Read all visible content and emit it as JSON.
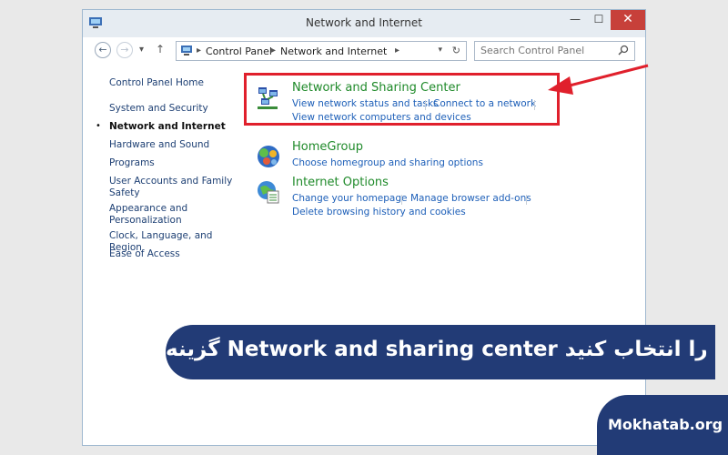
{
  "window": {
    "title": "Network and Internet",
    "min_glyph": "—",
    "max_glyph": "☐",
    "close_glyph": "✕"
  },
  "address": {
    "back_glyph": "←",
    "forward_glyph": "→",
    "recent_glyph": "▾",
    "up_glyph": "↑",
    "crumbs": [
      "Control Panel",
      "Network and Internet"
    ],
    "sep_glyph": "▸",
    "dropdown_glyph": "▾",
    "refresh_glyph": "↻",
    "search_placeholder": "Search Control Panel"
  },
  "sidebar": {
    "items": [
      {
        "label": "Control Panel Home"
      },
      {
        "label": "System and Security"
      },
      {
        "label": "Network and Internet",
        "active": true
      },
      {
        "label": "Hardware and Sound"
      },
      {
        "label": "Programs"
      },
      {
        "label": "User Accounts and Family Safety"
      },
      {
        "label": "Appearance and Personalization"
      },
      {
        "label": "Clock, Language, and Region"
      },
      {
        "label": "Ease of Access"
      }
    ],
    "bullet": "•"
  },
  "categories": [
    {
      "title": "Network and Sharing Center",
      "icon": "network-sharing-icon",
      "links": [
        "View network status and tasks",
        "Connect to a network",
        "View network computers and devices"
      ]
    },
    {
      "title": "HomeGroup",
      "icon": "homegroup-icon",
      "links": [
        "Choose homegroup and sharing options"
      ]
    },
    {
      "title": "Internet Options",
      "icon": "internet-options-icon",
      "links": [
        "Change your homepage",
        "Manage browser add-ons",
        "Delete browsing history and cookies"
      ]
    }
  ],
  "overlay": {
    "banner_text": "گزینه Network and sharing center را انتخاب کنید",
    "brand_text": "Mokhatab.org"
  },
  "colors": {
    "highlight": "#e0202c",
    "banner": "#223b76",
    "category_title": "#1f8a2a",
    "link": "#1d5fb8"
  }
}
